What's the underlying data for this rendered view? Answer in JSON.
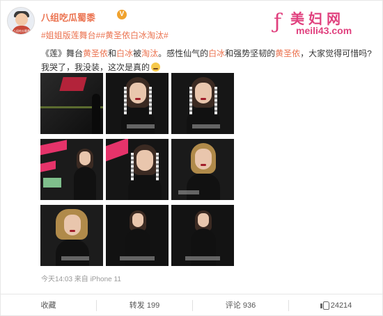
{
  "post": {
    "username": "八组吃瓜蜀黍",
    "verified_badge": "V",
    "avatar_label": "八组吃瓜蜀黍",
    "hashtags": "#姐姐版莲舞台##黄圣依白冰淘汰#",
    "text_line1": {
      "p1": "《莲》舞台",
      "h1": "黄圣依",
      "p2": "和",
      "h2": "白冰",
      "p3": "被",
      "h3": "淘汰",
      "p4": "。感性仙气的",
      "h4": "白冰",
      "p5": "和强势坚韧的",
      "h5": "黄圣依",
      "p6": "，大家觉得可惜吗?"
    },
    "text_line2": "我哭了，我没装，这次是真的",
    "highlight_color": "#eb7350",
    "meta": "今天14:03 来自 iPhone 11",
    "images": [
      {
        "name": "photo-1",
        "scene": "stage-red"
      },
      {
        "name": "photo-2",
        "scene": "portrait"
      },
      {
        "name": "photo-3",
        "scene": "portrait"
      },
      {
        "name": "photo-4",
        "scene": "pink-stage"
      },
      {
        "name": "photo-5",
        "scene": "pink-stage-crying"
      },
      {
        "name": "photo-6",
        "scene": "portrait-gold"
      },
      {
        "name": "photo-7",
        "scene": "portrait-gold"
      },
      {
        "name": "photo-8",
        "scene": "dark-stage"
      },
      {
        "name": "photo-9",
        "scene": "dark-stage"
      }
    ]
  },
  "watermark": {
    "title": "美妇网",
    "url": "meili43.com",
    "color": "#e0407e"
  },
  "actions": {
    "favorite": "收藏",
    "repost": "转发 199",
    "comment": "评论 936",
    "like": "24214"
  }
}
